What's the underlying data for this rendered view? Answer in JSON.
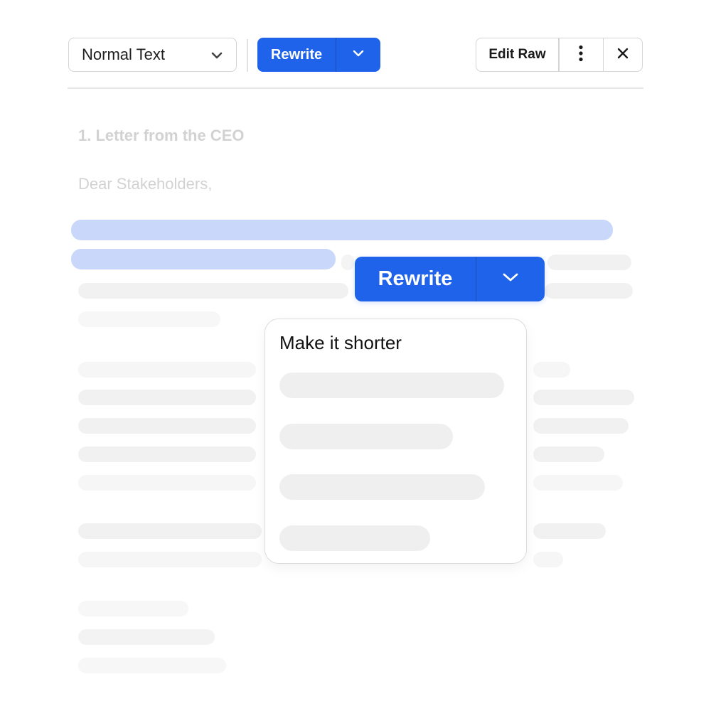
{
  "toolbar": {
    "text_style": {
      "value": "Normal Text",
      "icon": "chevron-down-icon"
    },
    "rewrite": {
      "label": "Rewrite",
      "icon": "chevron-down-icon"
    },
    "edit_raw_label": "Edit Raw",
    "more_icon": "vertical-ellipsis-icon",
    "close_icon": "close-icon"
  },
  "document": {
    "heading": "1. Letter from the CEO",
    "greeting": "Dear Stakeholders,"
  },
  "floating_rewrite": {
    "label": "Rewrite",
    "icon": "chevron-down-icon"
  },
  "rewrite_menu": {
    "first_option": "Make it shorter"
  },
  "colors": {
    "accent": "#1f63ea",
    "selection": "#c9d8fa",
    "border": "#d4d4d4",
    "skeleton": "#efefef",
    "faded_text": "#d2d2d2"
  }
}
